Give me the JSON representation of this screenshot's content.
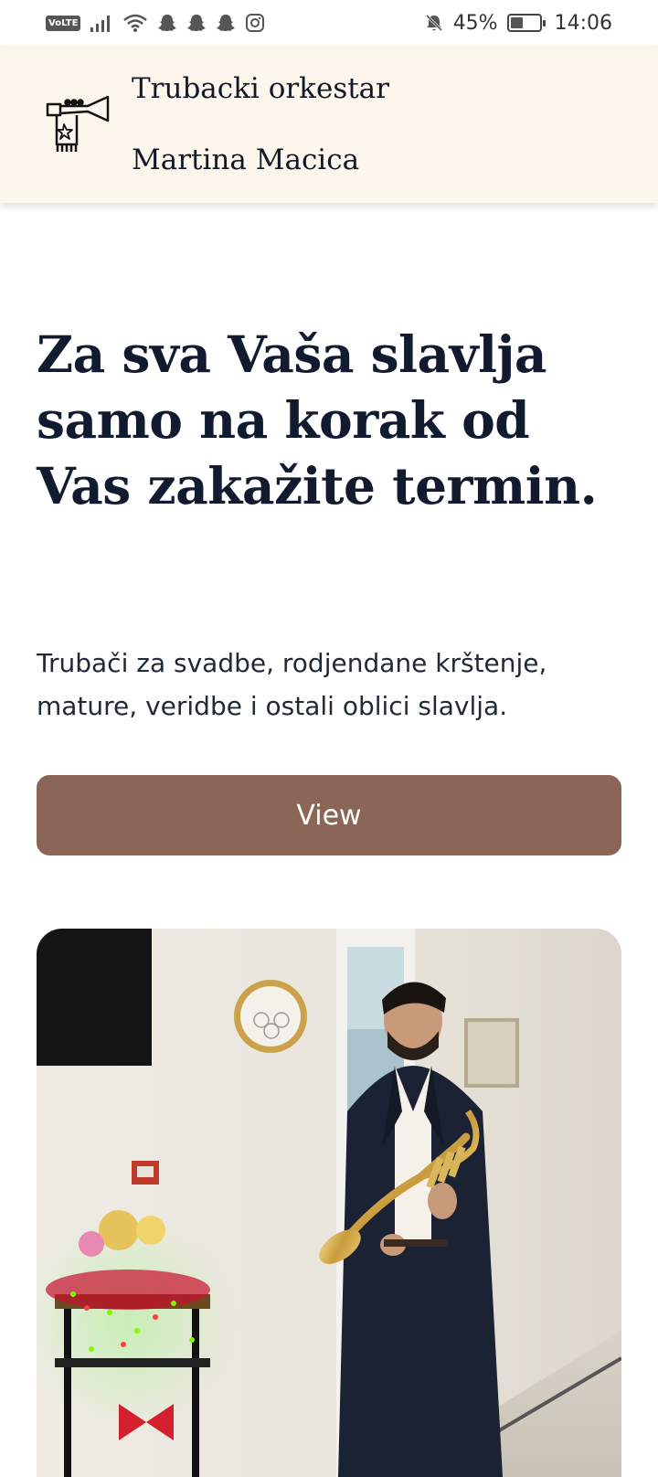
{
  "status_bar": {
    "volte": "VoLTE",
    "battery": "45%",
    "time": "14:06",
    "battery_level": 0.45,
    "icons": [
      "volte-icon",
      "signal-icon",
      "wifi-icon",
      "snapchat-icon",
      "snapchat-icon",
      "snapchat-icon",
      "instagram-icon",
      "bell-muted-icon",
      "battery-icon"
    ]
  },
  "header": {
    "logo_icon": "trumpet-logo-icon",
    "brand_line1": "Trubacki orkestar",
    "brand_line2": "Martina Macica"
  },
  "hero": {
    "title": "Za sva Vaša slavlja samo na korak od Vas zakažite termin.",
    "text": "Trubači za svadbe, rodjendane krštenje, mature, veridbe i ostali oblici slavlja.",
    "button_label": "View"
  },
  "colors": {
    "header_bg": "#fdf6ec",
    "button_bg": "#8b6657",
    "title_color": "#111a2e"
  }
}
